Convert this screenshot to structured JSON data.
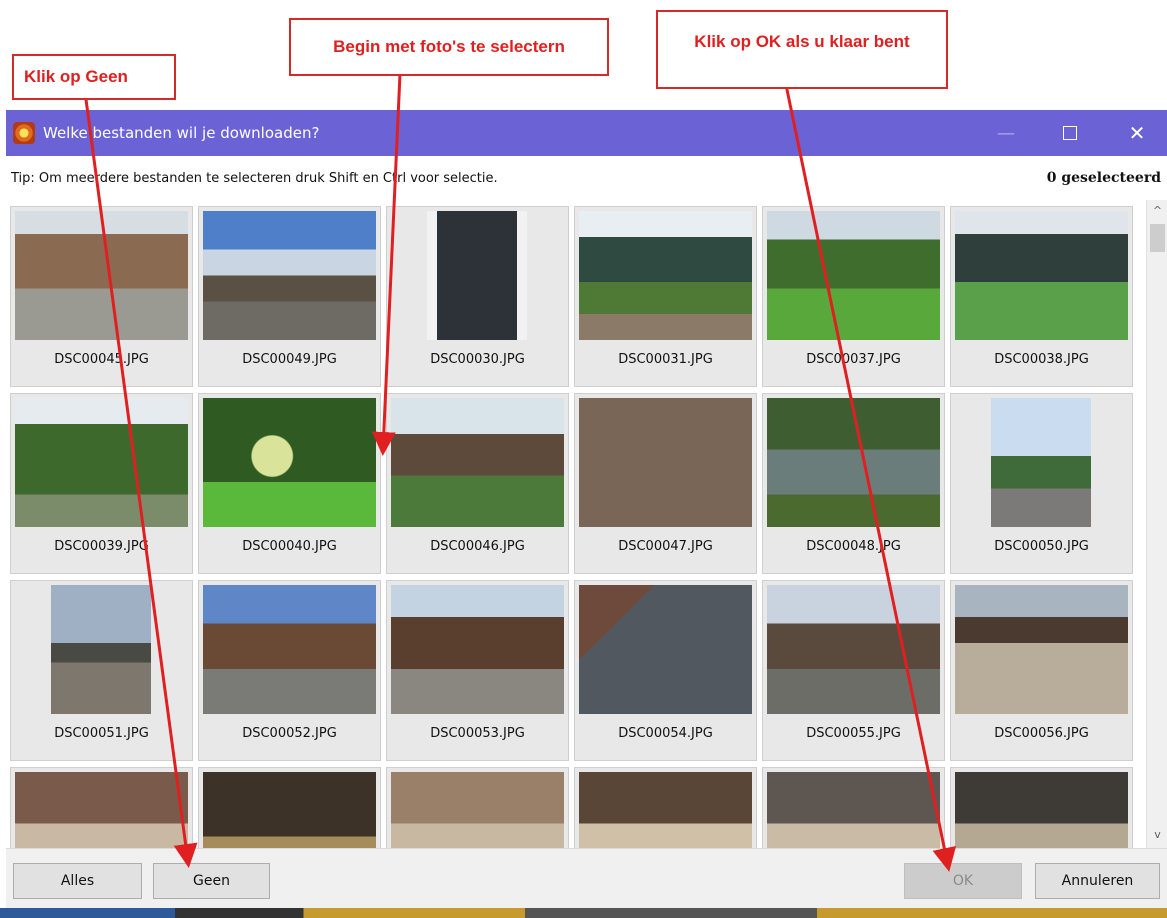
{
  "annotations": {
    "geen_note": "Klik op Geen",
    "select_note": "Begin met foto's te selectern",
    "ok_note": "Klik op OK als u klaar bent"
  },
  "colors": {
    "titlebar": "#6b62d6",
    "annotation_red": "#e02020"
  },
  "dialog": {
    "title": "Welke bestanden wil je downloaden?",
    "icon": "photo-app-icon",
    "controls": {
      "minimize": "—",
      "maximize": "maximize-icon",
      "close": "✕"
    },
    "tip": "Tip: Om meerdere bestanden te selecteren druk Shift en Ctrl voor selectie.",
    "selected_count": "0 geselecteerd"
  },
  "files": [
    {
      "name": "DSC00045.JPG"
    },
    {
      "name": "DSC00049.JPG"
    },
    {
      "name": "DSC00030.JPG"
    },
    {
      "name": "DSC00031.JPG"
    },
    {
      "name": "DSC00037.JPG"
    },
    {
      "name": "DSC00038.JPG"
    },
    {
      "name": "DSC00039.JPG"
    },
    {
      "name": "DSC00040.JPG"
    },
    {
      "name": "DSC00046.JPG"
    },
    {
      "name": "DSC00047.JPG"
    },
    {
      "name": "DSC00048.JPG"
    },
    {
      "name": "DSC00050.JPG"
    },
    {
      "name": "DSC00051.JPG"
    },
    {
      "name": "DSC00052.JPG"
    },
    {
      "name": "DSC00053.JPG"
    },
    {
      "name": "DSC00054.JPG"
    },
    {
      "name": "DSC00055.JPG"
    },
    {
      "name": "DSC00056.JPG"
    },
    {
      "name": ""
    },
    {
      "name": ""
    },
    {
      "name": ""
    },
    {
      "name": ""
    },
    {
      "name": ""
    },
    {
      "name": ""
    }
  ],
  "buttons": {
    "all": "Alles",
    "none": "Geen",
    "ok": "OK",
    "cancel": "Annuleren"
  },
  "scrollbar": {
    "up": "^",
    "down": "v"
  }
}
